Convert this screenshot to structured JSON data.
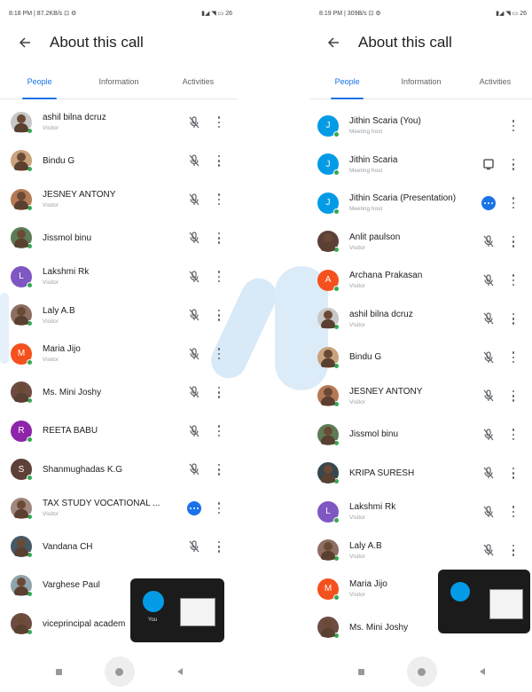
{
  "colors": {
    "accent": "#1a73e8",
    "online": "#34a853",
    "watermark": "#cfe4f7"
  },
  "left": {
    "status_time": "8:18 PM | 87.2KB/s ⊡ ⚙",
    "status_right": "▮◢ ◥ ▭ 26",
    "title": "About this call",
    "tabs": [
      "People",
      "Information",
      "Activities"
    ],
    "people": [
      {
        "name": "ashil bilna dcruz",
        "sub": "Visitor",
        "avatar": "photo",
        "color": "#c7c7c7",
        "mic": true
      },
      {
        "name": "Bindu G",
        "sub": "",
        "avatar": "photo",
        "color": "#c9a27e",
        "mic": true
      },
      {
        "name": "JESNEY ANTONY",
        "sub": "Visitor",
        "avatar": "photo",
        "color": "#b57a55",
        "mic": true
      },
      {
        "name": "Jissmol binu",
        "sub": "",
        "avatar": "photo",
        "color": "#5d7b55",
        "mic": true
      },
      {
        "name": "Lakshmi Rk",
        "sub": "Visitor",
        "avatar": "L",
        "color": "#7e57c2",
        "mic": true
      },
      {
        "name": "Laly A.B",
        "sub": "Visitor",
        "avatar": "photo",
        "color": "#8d6e63",
        "mic": true
      },
      {
        "name": "Maria Jijo",
        "sub": "Visitor",
        "avatar": "M",
        "color": "#f4511e",
        "mic": true
      },
      {
        "name": "Ms. Mini Joshy",
        "sub": "",
        "avatar": "photo",
        "color": "#6d4c41",
        "mic": true
      },
      {
        "name": "REETA BABU",
        "sub": "",
        "avatar": "R",
        "color": "#8e24aa",
        "mic": true
      },
      {
        "name": "Shanmughadas K.G",
        "sub": "",
        "avatar": "S",
        "color": "#5d4037",
        "mic": true
      },
      {
        "name": "TAX STUDY VOCATIONAL ...",
        "sub": "Visitor",
        "avatar": "photo",
        "color": "#a1887f",
        "mic": false,
        "badge": true
      },
      {
        "name": "Vandana CH",
        "sub": "",
        "avatar": "photo",
        "color": "#455a64",
        "mic": true
      },
      {
        "name": "Varghese Paul",
        "sub": "",
        "avatar": "photo",
        "color": "#90a4ae",
        "mic": false
      },
      {
        "name": "viceprincipal academ",
        "sub": "",
        "avatar": "photo",
        "color": "#6d4c41",
        "mic": false
      }
    ],
    "pip_label": "You"
  },
  "right": {
    "status_time": "8:19 PM | 309B/s ⊡ ⚙",
    "status_right": "▮◢ ◥ ▭ 26",
    "title": "About this call",
    "tabs": [
      "People",
      "Information",
      "Activities"
    ],
    "people": [
      {
        "name": "Jithin Scaria (You)",
        "sub": "Meeting host",
        "avatar": "J",
        "color": "#039be5",
        "action": "none"
      },
      {
        "name": "Jithin Scaria",
        "sub": "Meeting host",
        "avatar": "J",
        "color": "#039be5",
        "action": "screen"
      },
      {
        "name": "Jithin Scaria (Presentation)",
        "sub": "Meeting host",
        "avatar": "J",
        "color": "#039be5",
        "action": "badge"
      },
      {
        "name": "Anlit paulson",
        "sub": "Visitor",
        "avatar": "photo",
        "color": "#5d4037",
        "action": "mic"
      },
      {
        "name": "Archana Prakasan",
        "sub": "Visitor",
        "avatar": "A",
        "color": "#f4511e",
        "action": "mic"
      },
      {
        "name": "ashil bilna dcruz",
        "sub": "Visitor",
        "avatar": "photo",
        "color": "#c7c7c7",
        "action": "mic"
      },
      {
        "name": "Bindu G",
        "sub": "",
        "avatar": "photo",
        "color": "#c9a27e",
        "action": "mic"
      },
      {
        "name": "JESNEY ANTONY",
        "sub": "Visitor",
        "avatar": "photo",
        "color": "#b57a55",
        "action": "mic"
      },
      {
        "name": "Jissmol binu",
        "sub": "",
        "avatar": "photo",
        "color": "#5d7b55",
        "action": "mic"
      },
      {
        "name": "KRIPA SURESH",
        "sub": "",
        "avatar": "photo",
        "color": "#37474f",
        "action": "mic"
      },
      {
        "name": "Lakshmi Rk",
        "sub": "Visitor",
        "avatar": "L",
        "color": "#7e57c2",
        "action": "mic"
      },
      {
        "name": "Laly A.B",
        "sub": "Visitor",
        "avatar": "photo",
        "color": "#8d6e63",
        "action": "mic"
      },
      {
        "name": "Maria Jijo",
        "sub": "Visitor",
        "avatar": "M",
        "color": "#f4511e",
        "action": "none"
      },
      {
        "name": "Ms. Mini Joshy",
        "sub": "",
        "avatar": "photo",
        "color": "#6d4c41",
        "action": "none"
      }
    ]
  },
  "icons": {
    "back": "arrow-left-icon",
    "mic_off": "mic-off-icon",
    "more": "more-vert-icon",
    "present": "present-screen-icon",
    "nav_recents": "square-icon",
    "nav_home": "circle-icon",
    "nav_back": "triangle-back-icon"
  }
}
